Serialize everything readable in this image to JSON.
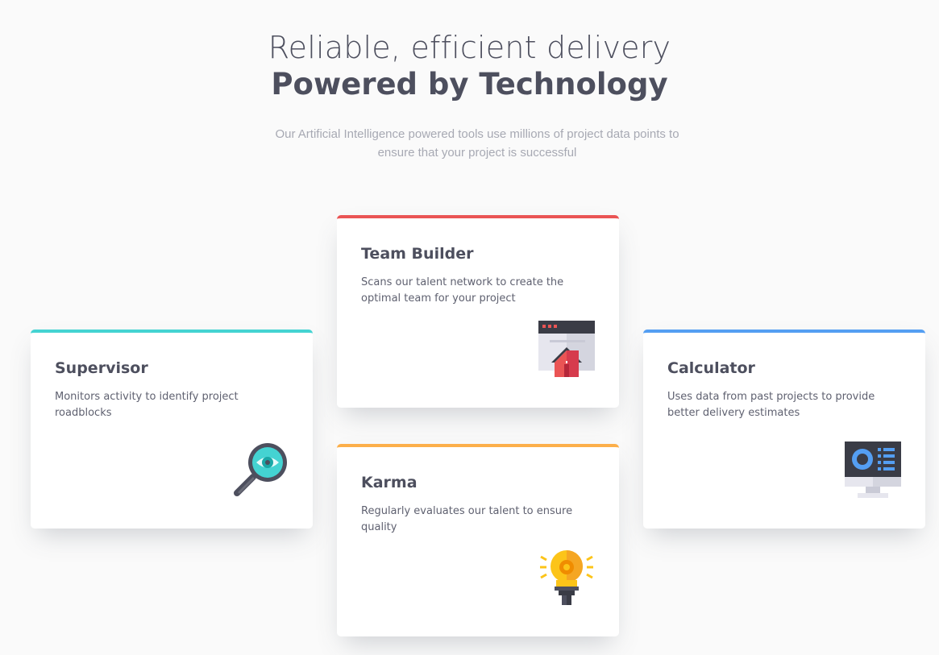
{
  "hero": {
    "line1": "Reliable, efficient delivery",
    "line2": "Powered by Technology",
    "description": "Our Artificial Intelligence powered tools use millions of project data points to ensure that your project is successful"
  },
  "colors": {
    "supervisor": "#44d3d2",
    "team_builder": "#ea5454",
    "karma": "#fcaf4a",
    "calculator": "#549ef2",
    "text_dark": "#4d4f5e",
    "text_muted": "#a7a9b3"
  },
  "cards": {
    "supervisor": {
      "title": "Supervisor",
      "text": "Monitors activity to identify project roadblocks",
      "icon": "magnifier-eye-icon"
    },
    "team_builder": {
      "title": "Team Builder",
      "text": "Scans our talent network to create the optimal team for your project",
      "icon": "browser-house-icon"
    },
    "karma": {
      "title": "Karma",
      "text": "Regularly evaluates our talent to ensure quality",
      "icon": "lightbulb-icon"
    },
    "calculator": {
      "title": "Calculator",
      "text": "Uses data from past projects to provide better delivery estimates",
      "icon": "monitor-chart-icon"
    }
  }
}
